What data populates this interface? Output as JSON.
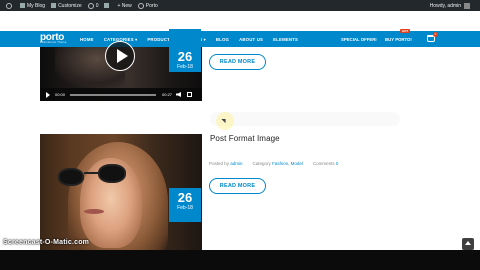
{
  "adminbar": {
    "site_name": "My Blog",
    "customize": "Customize",
    "updates": "0",
    "new_label": "New",
    "theme": "Porto",
    "greeting": "Howdy, admin"
  },
  "header": {
    "logo": "porto",
    "logo_tagline": "eCommerce Theme",
    "nav": [
      "HOME",
      "CATEGORIES",
      "PRODUCTS",
      "PAGES",
      "BLOG",
      "ABOUT US",
      "ELEMENTS"
    ],
    "special_offer": "SPECIAL OFFER!",
    "buy_porto": "BUY PORTO!",
    "hot_badge": "HOT",
    "cart_count": "0"
  },
  "post1": {
    "date_day": "26",
    "date_month": "Feb-18",
    "video_time_current": "00:00",
    "video_time_total": "00:27",
    "read_more": "READ MORE"
  },
  "post2": {
    "title": "Post Format Image",
    "posted_by_label": "Posted by",
    "author": "admin",
    "category_label": "Category",
    "categories": "Fashion, Model",
    "comments_label": "Comments",
    "comments": "0",
    "date_day": "26",
    "date_month": "Feb-18",
    "read_more": "READ MORE"
  },
  "watermark": "Screencast-O-Matic.com",
  "colors": {
    "primary": "#0088cc",
    "adminbar": "#23282d",
    "hot": "#e2401c"
  }
}
